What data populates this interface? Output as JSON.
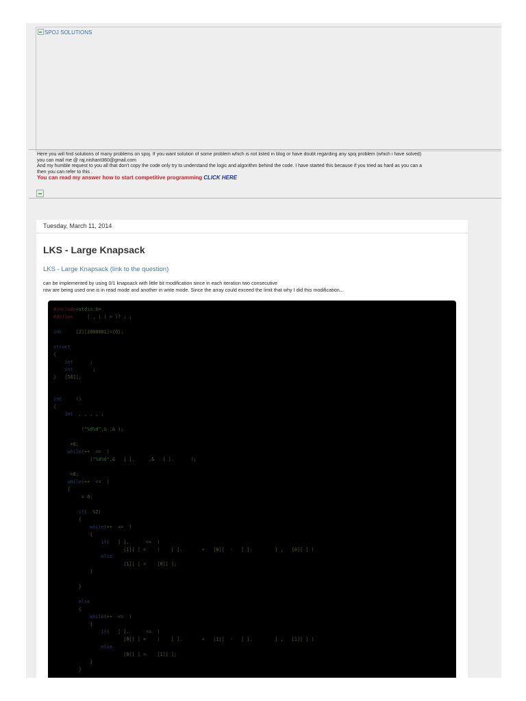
{
  "header": {
    "image_alt": "SPOJ SOLUTIONS",
    "description_lines": [
      "Here you will find solutions of many problems on spoj. If you want solution of some problem which is not listed in blog or have doubt regarding any spoj problem (which i have solved)",
      "you can mail me @ raj.nishant360@gmail.com",
      "And my humble request to you all that don't copy the code only try to understand the logic and algorithm behind the code. I have started this because if you tried as hard as you can a",
      "then you can refer to this ."
    ],
    "competitive_text": "You can read my answer how to start competitive programming",
    "click_here": "CLICK HERE"
  },
  "post": {
    "date": "Tuesday, March 11, 2014",
    "title": "LKS - Large Knapsack",
    "question_link": "LKS - Large Knapsack (link to the question)",
    "body_lines": [
      "can be implemented by using 0/1 knapsack with little bit modification since in each iteration two consecutive",
      "row are being used one is in read mode and another in write mode. Since the array could exceed the limit that why I did this modification..."
    ]
  },
  "code": {
    "lines": [
      [
        [
          "pp",
          "#include"
        ],
        [
          "s",
          "<stdio.h>"
        ]
      ],
      [
        [
          "pp",
          "#define"
        ],
        [
          "n",
          "     ( , ) ( > )? : ;"
        ]
      ],
      [
        [
          "n",
          ""
        ]
      ],
      [
        [
          "k",
          "int"
        ],
        [
          "n",
          "     [2][2000001]={0};"
        ]
      ],
      [
        [
          "n",
          ""
        ]
      ],
      [
        [
          "k",
          "struct"
        ]
      ],
      [
        [
          "n",
          "{"
        ]
      ],
      [
        [
          "n",
          "    "
        ],
        [
          "k",
          "int"
        ],
        [
          "n",
          "      ;"
        ]
      ],
      [
        [
          "n",
          "    "
        ],
        [
          "k",
          "int"
        ],
        [
          "n",
          "       ;"
        ]
      ],
      [
        [
          "n",
          "}   [501];"
        ]
      ],
      [
        [
          "n",
          ""
        ]
      ],
      [
        [
          "n",
          ""
        ]
      ],
      [
        [
          "k",
          "int"
        ],
        [
          "n",
          "     ()"
        ]
      ],
      [
        [
          "n",
          "{"
        ]
      ],
      [
        [
          "n",
          "    "
        ],
        [
          "k",
          "int"
        ],
        [
          "n",
          "  , , , , ;"
        ]
      ],
      [
        [
          "n",
          ""
        ]
      ],
      [
        [
          "n",
          "          ("
        ],
        [
          "s",
          "\"%d%d\""
        ],
        [
          "n",
          ",& ,& );"
        ]
      ],
      [
        [
          "n",
          ""
        ]
      ],
      [
        [
          "n",
          "      =0;"
        ]
      ],
      [
        [
          "n",
          "     "
        ],
        [
          "k",
          "while"
        ],
        [
          "n",
          "(++  <=  )"
        ]
      ],
      [
        [
          "n",
          "             ("
        ],
        [
          "s",
          "\"%d%d\""
        ],
        [
          "n",
          ",&   [ ].     ,&   [ ].      );"
        ]
      ],
      [
        [
          "n",
          ""
        ]
      ],
      [
        [
          "n",
          "      =0;"
        ]
      ],
      [
        [
          "n",
          "     "
        ],
        [
          "k",
          "while"
        ],
        [
          "n",
          "(++  <=  )"
        ]
      ],
      [
        [
          "n",
          "     {"
        ]
      ],
      [
        [
          "n",
          "          = 0;"
        ]
      ],
      [
        [
          "n",
          ""
        ]
      ],
      [
        [
          "n",
          "         "
        ],
        [
          "k",
          "if"
        ],
        [
          "n",
          "(  %2)"
        ]
      ],
      [
        [
          "n",
          "         {"
        ]
      ],
      [
        [
          "n",
          "             "
        ],
        [
          "k",
          "while"
        ],
        [
          "n",
          "(++  <=  )"
        ]
      ],
      [
        [
          "n",
          "             {"
        ]
      ],
      [
        [
          "n",
          "                 "
        ],
        [
          "k",
          "if"
        ],
        [
          "n",
          "(   [ ].      <=  )"
        ]
      ],
      [
        [
          "n",
          "                         [1][ ] =    (    [ ].       +   [0][  -   [ ].        ] ,   [0][ ] )"
        ]
      ],
      [
        [
          "n",
          "                 "
        ],
        [
          "k",
          "else"
        ]
      ],
      [
        [
          "n",
          "                         [1][ ] =    [0][ ];"
        ]
      ],
      [
        [
          "n",
          "             }"
        ]
      ],
      [
        [
          "n",
          ""
        ]
      ],
      [
        [
          "n",
          "         }"
        ]
      ],
      [
        [
          "n",
          ""
        ]
      ],
      [
        [
          "n",
          "         "
        ],
        [
          "k",
          "else"
        ]
      ],
      [
        [
          "n",
          "         {"
        ]
      ],
      [
        [
          "n",
          "             "
        ],
        [
          "k",
          "while"
        ],
        [
          "n",
          "(++  <=  )"
        ]
      ],
      [
        [
          "n",
          "             {"
        ]
      ],
      [
        [
          "n",
          "                 "
        ],
        [
          "k",
          "if"
        ],
        [
          "n",
          "(   [ ].      <=  )"
        ]
      ],
      [
        [
          "n",
          "                         [0][ ] =    (    [ ].       +   [1][  -   [ ].        ] ,   [1][ ] )"
        ]
      ],
      [
        [
          "n",
          "                 "
        ],
        [
          "k",
          "else"
        ]
      ],
      [
        [
          "n",
          "                         [0][ ] =    [1][ ];"
        ]
      ],
      [
        [
          "n",
          "             }"
        ]
      ],
      [
        [
          "n",
          "         }"
        ]
      ]
    ]
  }
}
